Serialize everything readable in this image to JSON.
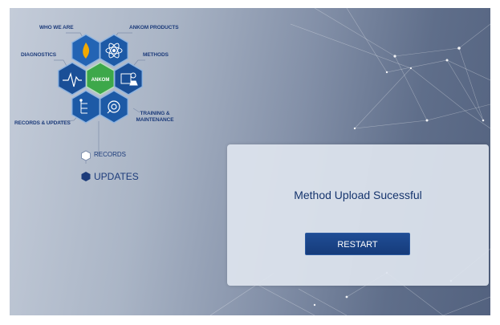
{
  "nav": {
    "who_we_are": "WHO WE ARE",
    "ankom_products": "ANKOM PRODUCTS",
    "diagnostics": "DIAGNOSTICS",
    "methods": "METHODS",
    "center_logo": "ANKOM",
    "records_updates": "RECORDS & UPDATES",
    "training_line1": "TRAINING &",
    "training_line2": "MAINTENANCE"
  },
  "submenu": {
    "records": "RECORDS",
    "updates": "UPDATES"
  },
  "dialog": {
    "message": "Method Upload Sucessful",
    "restart_label": "RESTART"
  },
  "colors": {
    "navy": "#1c3b7a",
    "hex_fill": "#1e5aa8",
    "center_hex": "#3da84a",
    "button": "#1a4488"
  },
  "icons": {
    "who_we_are": "flame-icon",
    "ankom_products": "atom-icon",
    "diagnostics": "pulse-icon",
    "methods": "flask-icon",
    "records_updates": "tree-icon",
    "training": "gear-wrench-icon"
  }
}
